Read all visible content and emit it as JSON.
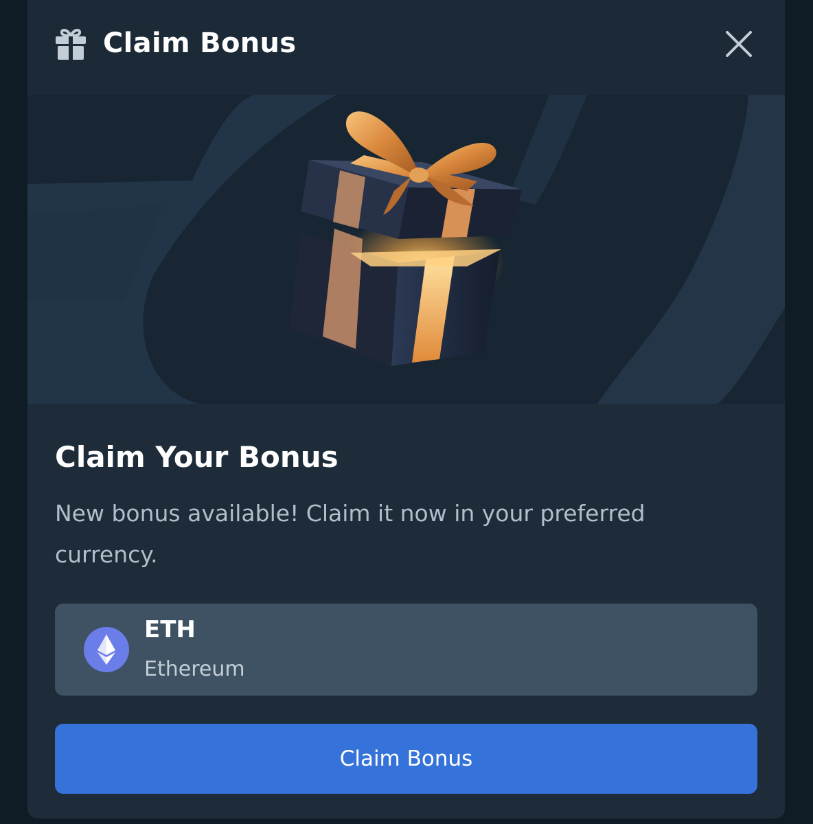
{
  "modal": {
    "title": "Claim Bonus",
    "header_icon": "gift-icon",
    "close_icon": "close-icon"
  },
  "hero": {
    "image": "gift-box-illustration"
  },
  "content": {
    "title": "Claim Your Bonus",
    "description": "New bonus available! Claim it now in your preferred currency."
  },
  "currency": {
    "code": "ETH",
    "name": "Ethereum",
    "icon": "ethereum-icon"
  },
  "action": {
    "claim_label": "Claim Bonus"
  },
  "colors": {
    "modal_bg": "#1b2a36",
    "card_bg": "#3e5263",
    "button_bg": "#3572d9",
    "ethereum": "#6b7de8",
    "text_secondary": "#b2becb"
  }
}
